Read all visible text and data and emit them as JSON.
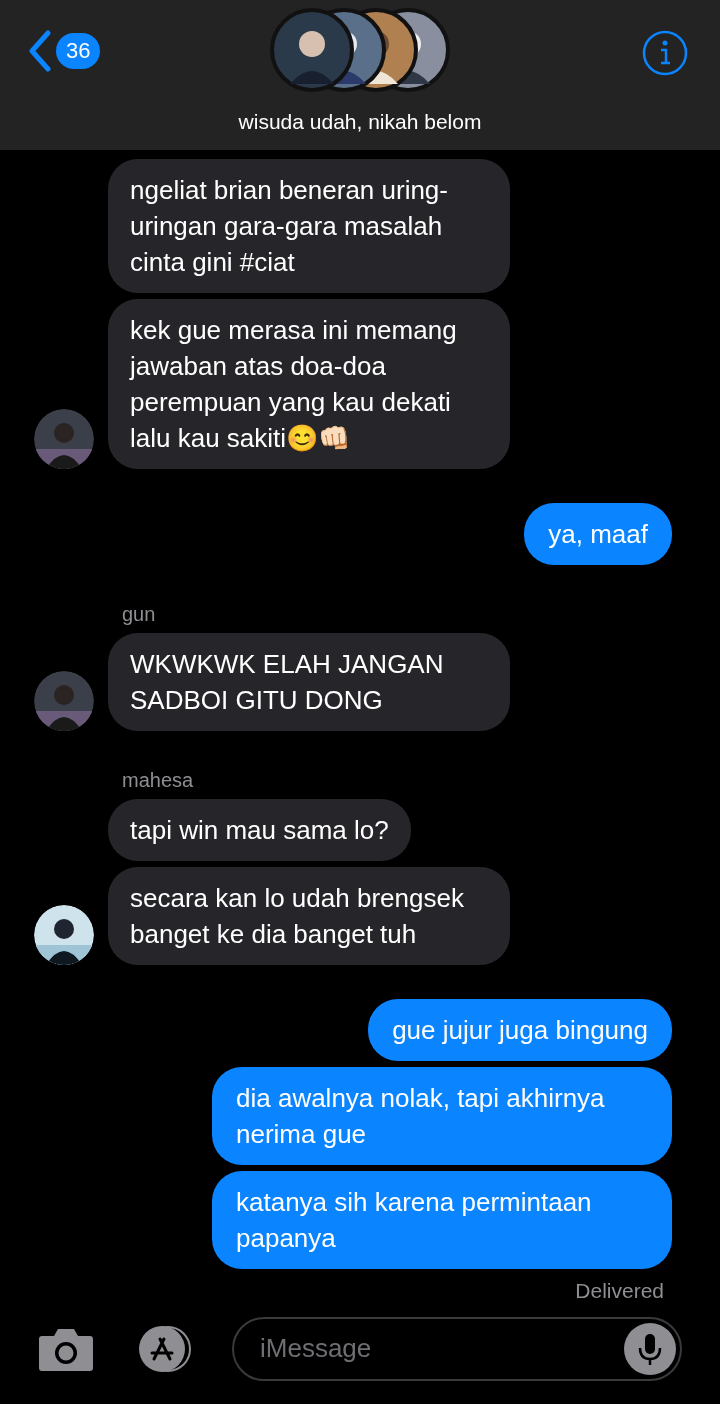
{
  "header": {
    "back_count": "36",
    "title": "wisuda udah, nikah belom"
  },
  "messages": [
    {
      "kind": "received",
      "text": "ngeliat brian beneran uring-uringan gara-gara masalah cinta gini #ciat",
      "avatar": false
    },
    {
      "kind": "received",
      "text": "kek gue merasa ini memang jawaban atas doa-doa perempuan yang kau dekati lalu kau sakiti😊👊🏻",
      "avatar": true
    },
    {
      "kind": "sent",
      "text": "ya, maaf"
    },
    {
      "kind": "received",
      "sender": "gun",
      "text": "WKWKWK ELAH JANGAN SADBOI GITU DONG",
      "avatar": true
    },
    {
      "kind": "received",
      "sender": "mahesa",
      "text": "tapi win mau sama lo?",
      "avatar": false
    },
    {
      "kind": "received",
      "text": "secara kan lo udah brengsek banget ke dia banget tuh",
      "avatar": true
    },
    {
      "kind": "sent",
      "text": "gue jujur juga bingung"
    },
    {
      "kind": "sent",
      "text": "dia awalnya nolak, tapi akhirnya nerima gue"
    },
    {
      "kind": "sent",
      "text": "katanya sih karena permintaan papanya"
    }
  ],
  "status": "Delivered",
  "composer": {
    "placeholder": "iMessage"
  }
}
